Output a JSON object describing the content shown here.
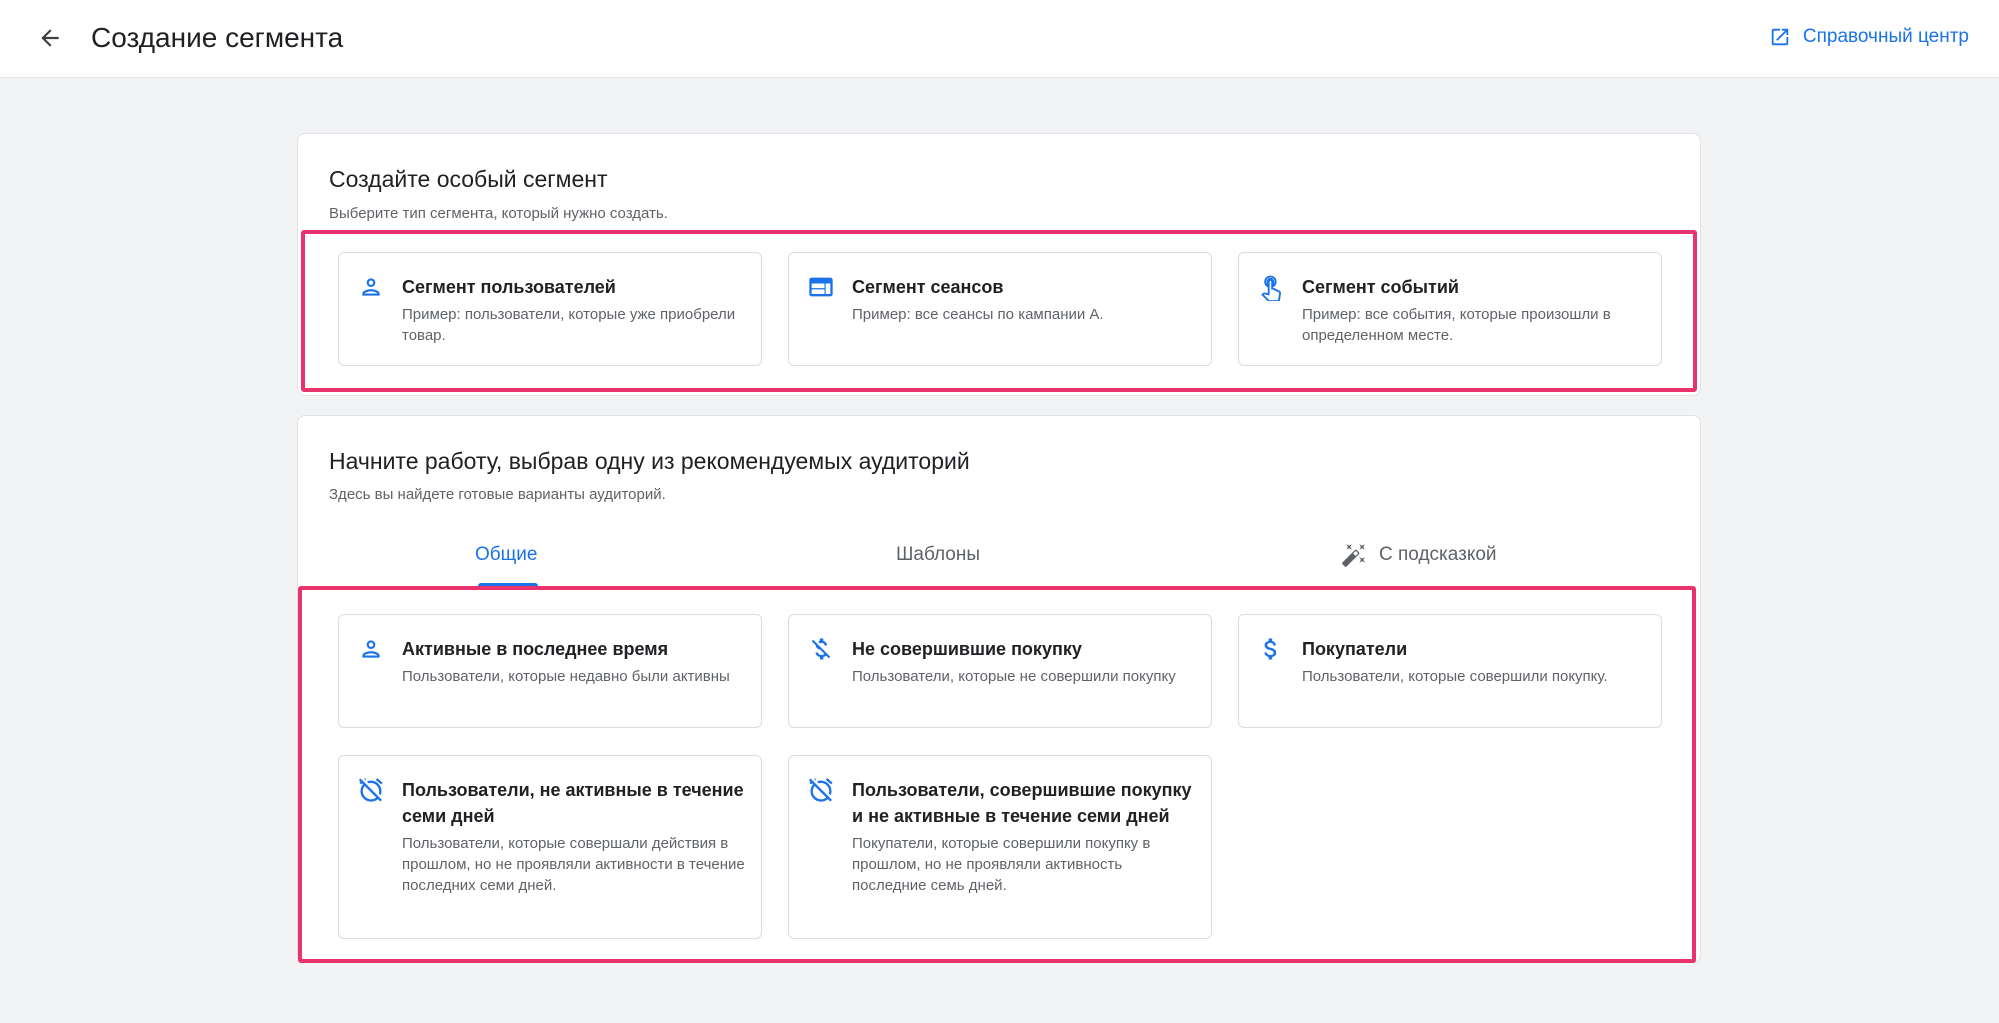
{
  "header": {
    "title": "Создание сегмента",
    "help_label": "Справочный центр"
  },
  "custom_section": {
    "title": "Создайте особый сегмент",
    "subtitle": "Выберите тип сегмента, который нужно создать.",
    "options": [
      {
        "title": "Сегмент пользователей",
        "description": "Пример: пользователи, которые уже приобрели товар.",
        "icon": "person-icon"
      },
      {
        "title": "Сегмент сеансов",
        "description": "Пример: все сеансы по кампании А.",
        "icon": "web-window-icon"
      },
      {
        "title": "Сегмент событий",
        "description": "Пример: все события, которые произошли в определенном месте.",
        "icon": "touch-hand-icon"
      }
    ]
  },
  "recommended_section": {
    "title": "Начните работу, выбрав одну из рекомендуемых аудиторий",
    "subtitle": "Здесь вы найдете готовые варианты аудиторий.",
    "tabs": [
      {
        "label": "Общие",
        "active": true
      },
      {
        "label": "Шаблоны",
        "active": false
      },
      {
        "label": "С подсказкой",
        "active": false,
        "icon": "magic-wand-icon"
      }
    ],
    "options": [
      {
        "title": "Активные в последнее время",
        "description": "Пользователи, которые недавно были активны",
        "icon": "person-icon"
      },
      {
        "title": "Не совершившие покупку",
        "description": "Пользователи, которые не совершили покупку",
        "icon": "money-off-icon"
      },
      {
        "title": "Покупатели",
        "description": "Пользователи, которые совершили покупку.",
        "icon": "dollar-icon"
      },
      {
        "title": "Пользователи, не активные в течение семи дней",
        "description": "Пользователи, которые совершали действия в прошлом, но не проявляли активности в течение последних семи дней.",
        "icon": "alarm-off-icon"
      },
      {
        "title": "Пользователи, совершившие покупку и не активные в течение семи дней",
        "description": "Покупатели, которые совершили покупку в прошлом, но не проявляли активность последние семь дней.",
        "icon": "alarm-off-icon"
      }
    ]
  },
  "colors": {
    "accent": "#1a73e8",
    "highlight": "#e8336d",
    "background": "#f1f3f4"
  }
}
